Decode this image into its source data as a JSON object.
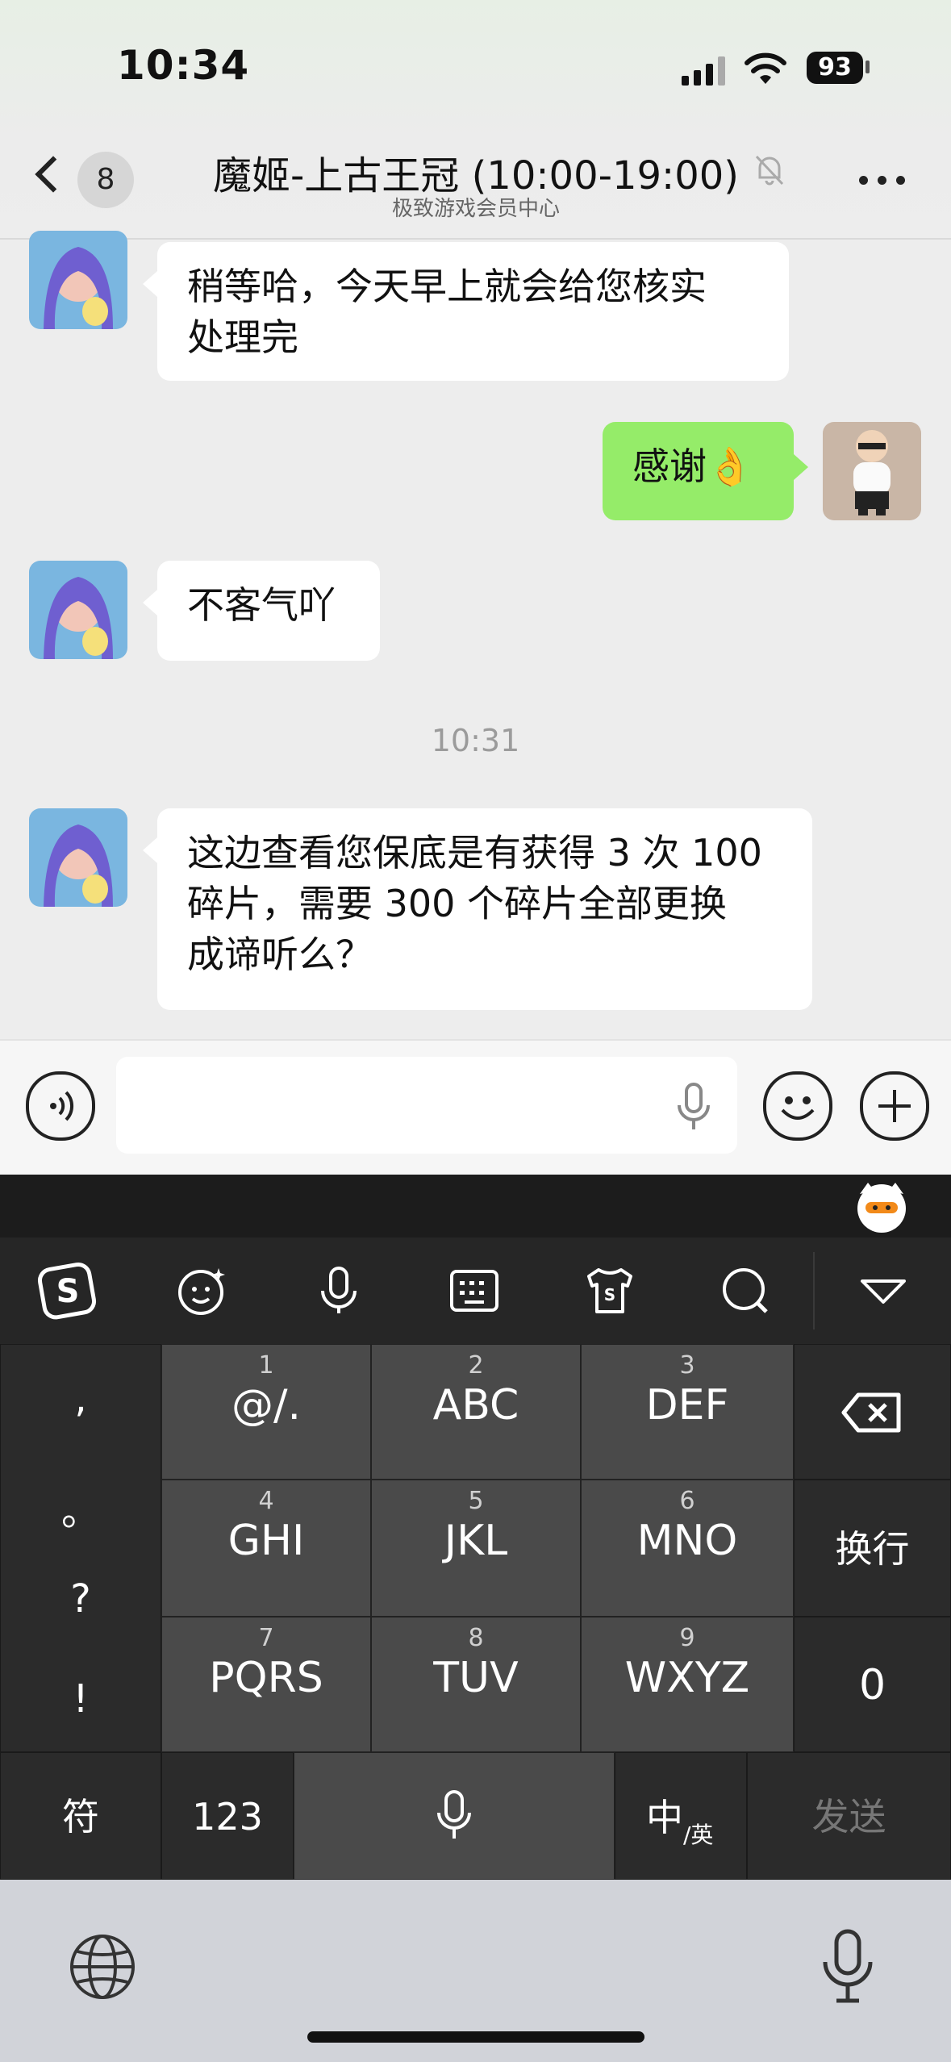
{
  "status_bar": {
    "time": "10:34",
    "battery": "93"
  },
  "header": {
    "back_count": "8",
    "title": "魔姬-上古王冠 (10:00-19:00)",
    "subtitle": "极致游戏会员中心"
  },
  "messages": [
    {
      "side": "left",
      "text_line1": "稍等哈，今天早上就会给您核实",
      "text_line2": "处理完"
    },
    {
      "side": "right",
      "text": "感谢👌"
    },
    {
      "side": "left",
      "text": "不客气吖"
    },
    {
      "side": "left",
      "text_line1": "这边查看您保底是有获得 3 次 100",
      "text_line2": "碎片，需要 300 个碎片全部更换",
      "text_line3": "成谛听么？"
    }
  ],
  "timestamp": "10:31",
  "keyboard": {
    "punctuation": [
      ",",
      "。",
      "?",
      "!"
    ],
    "keys": [
      {
        "num": "1",
        "label": "@/."
      },
      {
        "num": "2",
        "label": "ABC"
      },
      {
        "num": "3",
        "label": "DEF"
      },
      {
        "num": "4",
        "label": "GHI"
      },
      {
        "num": "5",
        "label": "JKL"
      },
      {
        "num": "6",
        "label": "MNO"
      },
      {
        "num": "7",
        "label": "PQRS"
      },
      {
        "num": "8",
        "label": "TUV"
      },
      {
        "num": "9",
        "label": "WXYZ"
      }
    ],
    "newline": "换行",
    "zero": "0",
    "symbols": "符",
    "numbers": "123",
    "lang_main": "中",
    "lang_sub": "/英",
    "send": "发送"
  }
}
